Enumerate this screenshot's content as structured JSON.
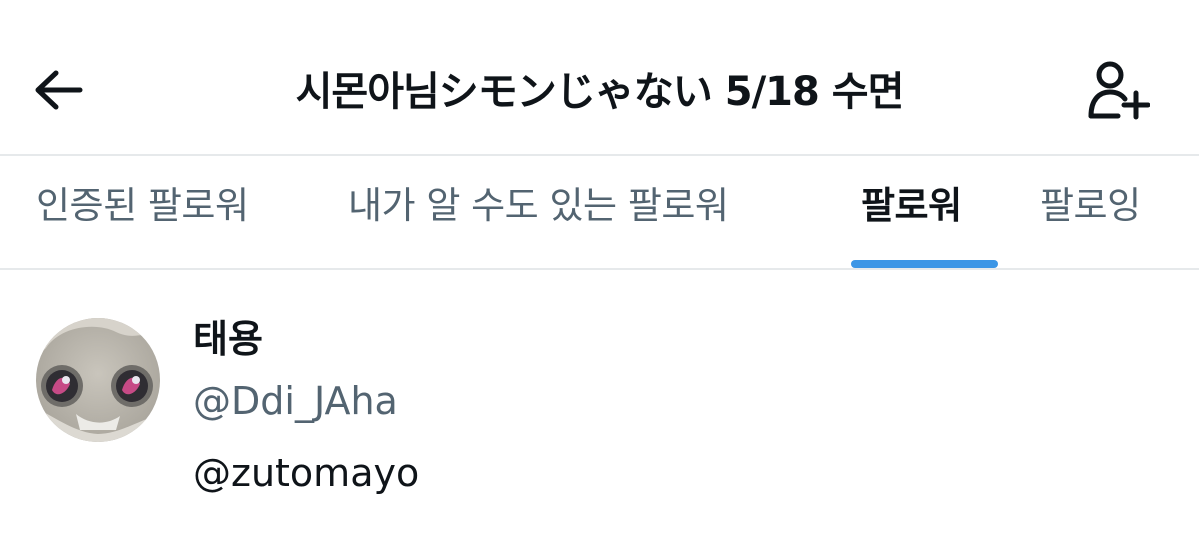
{
  "header": {
    "title": "시몬아님シモンじゃない 5/18 수면",
    "back_icon": "arrow-left-icon",
    "follow_icon": "person-add-icon"
  },
  "tabs": [
    {
      "label": "인증된 팔로워",
      "active": false
    },
    {
      "label": "내가 알 수도 있는 팔로워",
      "active": false
    },
    {
      "label": "팔로워",
      "active": true
    },
    {
      "label": "팔로잉",
      "active": false
    }
  ],
  "colors": {
    "accent": "#3c96e6",
    "text_primary": "#0f1419",
    "text_secondary": "#536471",
    "divider": "#e6e9eb"
  },
  "users": [
    {
      "display_name": "태용",
      "handle": "@Ddi_JAha",
      "bio": "@zutomayo"
    }
  ]
}
